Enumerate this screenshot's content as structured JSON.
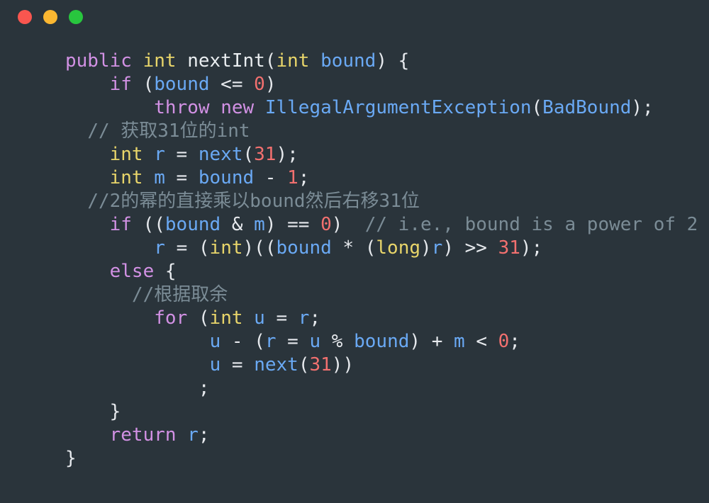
{
  "window": {
    "titlebar": {
      "close_label": "close",
      "minimize_label": "minimize",
      "maximize_label": "maximize"
    }
  },
  "theme": {
    "background": "#2a343b",
    "foreground": "#e6e9ed",
    "keyword": "#d291e4",
    "type": "#e8d56a",
    "variable": "#6aa9f4",
    "number": "#f2706f",
    "comment": "#7b8c96",
    "dot_close": "#f9564f",
    "dot_minimize": "#fbb731",
    "dot_maximize": "#28c63e"
  },
  "code": {
    "language": "java",
    "lines": [
      {
        "n": 1,
        "indent": 0,
        "tokens": [
          {
            "t": "public",
            "c": "kw"
          },
          {
            "t": " ",
            "c": "punc"
          },
          {
            "t": "int",
            "c": "type"
          },
          {
            "t": " ",
            "c": "punc"
          },
          {
            "t": "nextInt",
            "c": "fn"
          },
          {
            "t": "(",
            "c": "punc"
          },
          {
            "t": "int",
            "c": "type"
          },
          {
            "t": " ",
            "c": "punc"
          },
          {
            "t": "bound",
            "c": "var"
          },
          {
            "t": ") {",
            "c": "punc"
          }
        ]
      },
      {
        "n": 2,
        "indent": 4,
        "tokens": [
          {
            "t": "if",
            "c": "kw"
          },
          {
            "t": " (",
            "c": "punc"
          },
          {
            "t": "bound",
            "c": "var"
          },
          {
            "t": " <= ",
            "c": "punc"
          },
          {
            "t": "0",
            "c": "num"
          },
          {
            "t": ")",
            "c": "punc"
          }
        ]
      },
      {
        "n": 3,
        "indent": 8,
        "tokens": [
          {
            "t": "throw",
            "c": "kw"
          },
          {
            "t": " ",
            "c": "punc"
          },
          {
            "t": "new",
            "c": "kw"
          },
          {
            "t": " ",
            "c": "punc"
          },
          {
            "t": "IllegalArgumentException",
            "c": "var"
          },
          {
            "t": "(",
            "c": "punc"
          },
          {
            "t": "BadBound",
            "c": "var"
          },
          {
            "t": ");",
            "c": "punc"
          }
        ]
      },
      {
        "n": 4,
        "indent": 2,
        "tokens": [
          {
            "t": "// 获取31位的int",
            "c": "cmt"
          }
        ]
      },
      {
        "n": 5,
        "indent": 4,
        "tokens": [
          {
            "t": "int",
            "c": "type"
          },
          {
            "t": " ",
            "c": "punc"
          },
          {
            "t": "r",
            "c": "var"
          },
          {
            "t": " = ",
            "c": "punc"
          },
          {
            "t": "next",
            "c": "var"
          },
          {
            "t": "(",
            "c": "punc"
          },
          {
            "t": "31",
            "c": "num"
          },
          {
            "t": ");",
            "c": "punc"
          }
        ]
      },
      {
        "n": 6,
        "indent": 4,
        "tokens": [
          {
            "t": "int",
            "c": "type"
          },
          {
            "t": " ",
            "c": "punc"
          },
          {
            "t": "m",
            "c": "var"
          },
          {
            "t": " = ",
            "c": "punc"
          },
          {
            "t": "bound",
            "c": "var"
          },
          {
            "t": " - ",
            "c": "punc"
          },
          {
            "t": "1",
            "c": "num"
          },
          {
            "t": ";",
            "c": "punc"
          }
        ]
      },
      {
        "n": 7,
        "indent": 2,
        "tokens": [
          {
            "t": "//2的幂的直接乘以bound然后右移31位",
            "c": "cmt"
          }
        ]
      },
      {
        "n": 8,
        "indent": 4,
        "tokens": [
          {
            "t": "if",
            "c": "kw"
          },
          {
            "t": " ((",
            "c": "punc"
          },
          {
            "t": "bound",
            "c": "var"
          },
          {
            "t": " & ",
            "c": "punc"
          },
          {
            "t": "m",
            "c": "var"
          },
          {
            "t": ") == ",
            "c": "punc"
          },
          {
            "t": "0",
            "c": "num"
          },
          {
            "t": ")  ",
            "c": "punc"
          },
          {
            "t": "// i.e., bound is a power of 2",
            "c": "cmt"
          }
        ]
      },
      {
        "n": 9,
        "indent": 8,
        "tokens": [
          {
            "t": "r",
            "c": "var"
          },
          {
            "t": " = (",
            "c": "punc"
          },
          {
            "t": "int",
            "c": "type"
          },
          {
            "t": ")((",
            "c": "punc"
          },
          {
            "t": "bound",
            "c": "var"
          },
          {
            "t": " * (",
            "c": "punc"
          },
          {
            "t": "long",
            "c": "type"
          },
          {
            "t": ")",
            "c": "punc"
          },
          {
            "t": "r",
            "c": "var"
          },
          {
            "t": ") >> ",
            "c": "punc"
          },
          {
            "t": "31",
            "c": "num"
          },
          {
            "t": ");",
            "c": "punc"
          }
        ]
      },
      {
        "n": 10,
        "indent": 4,
        "tokens": [
          {
            "t": "else",
            "c": "kw"
          },
          {
            "t": " {",
            "c": "punc"
          }
        ]
      },
      {
        "n": 11,
        "indent": 6,
        "tokens": [
          {
            "t": "//根据取余",
            "c": "cmt"
          }
        ]
      },
      {
        "n": 12,
        "indent": 8,
        "tokens": [
          {
            "t": "for",
            "c": "kw"
          },
          {
            "t": " (",
            "c": "punc"
          },
          {
            "t": "int",
            "c": "type"
          },
          {
            "t": " ",
            "c": "punc"
          },
          {
            "t": "u",
            "c": "var"
          },
          {
            "t": " = ",
            "c": "punc"
          },
          {
            "t": "r",
            "c": "var"
          },
          {
            "t": ";",
            "c": "punc"
          }
        ]
      },
      {
        "n": 13,
        "indent": 13,
        "tokens": [
          {
            "t": "u",
            "c": "var"
          },
          {
            "t": " - (",
            "c": "punc"
          },
          {
            "t": "r",
            "c": "var"
          },
          {
            "t": " = ",
            "c": "punc"
          },
          {
            "t": "u",
            "c": "var"
          },
          {
            "t": " % ",
            "c": "punc"
          },
          {
            "t": "bound",
            "c": "var"
          },
          {
            "t": ") + ",
            "c": "punc"
          },
          {
            "t": "m",
            "c": "var"
          },
          {
            "t": " < ",
            "c": "punc"
          },
          {
            "t": "0",
            "c": "num"
          },
          {
            "t": ";",
            "c": "punc"
          }
        ]
      },
      {
        "n": 14,
        "indent": 13,
        "tokens": [
          {
            "t": "u",
            "c": "var"
          },
          {
            "t": " = ",
            "c": "punc"
          },
          {
            "t": "next",
            "c": "var"
          },
          {
            "t": "(",
            "c": "punc"
          },
          {
            "t": "31",
            "c": "num"
          },
          {
            "t": "))",
            "c": "punc"
          }
        ]
      },
      {
        "n": 15,
        "indent": 12,
        "tokens": [
          {
            "t": ";",
            "c": "punc"
          }
        ]
      },
      {
        "n": 16,
        "indent": 4,
        "tokens": [
          {
            "t": "}",
            "c": "punc"
          }
        ]
      },
      {
        "n": 17,
        "indent": 4,
        "tokens": [
          {
            "t": "return",
            "c": "kw"
          },
          {
            "t": " ",
            "c": "punc"
          },
          {
            "t": "r",
            "c": "var"
          },
          {
            "t": ";",
            "c": "punc"
          }
        ]
      },
      {
        "n": 18,
        "indent": 0,
        "tokens": [
          {
            "t": "}",
            "c": "punc"
          }
        ]
      }
    ]
  }
}
